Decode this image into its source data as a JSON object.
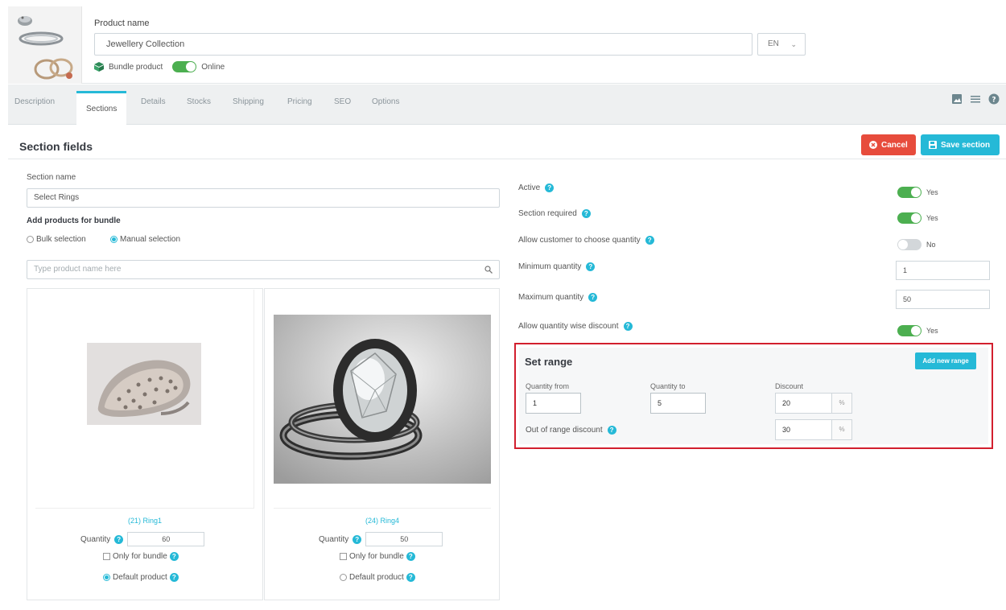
{
  "header": {
    "product_name_label": "Product name",
    "product_name_value": "Jewellery Collection",
    "language": "EN",
    "product_type": "Bundle product",
    "status_label": "Online"
  },
  "tabs": [
    "Description",
    "Sections",
    "Details",
    "Stocks",
    "Shipping",
    "Pricing",
    "SEO",
    "Options"
  ],
  "active_tab": "Sections",
  "section": {
    "title": "Section fields",
    "cancel_label": "Cancel",
    "save_label": "Save section"
  },
  "left": {
    "section_name_label": "Section name",
    "section_name_value": "Select Rings",
    "add_products_label": "Add products for bundle",
    "bulk_label": "Bulk selection",
    "manual_label": "Manual selection",
    "search_placeholder": "Type product name here"
  },
  "products": [
    {
      "link": "(21) Ring1",
      "quantity_label": "Quantity",
      "quantity": "60",
      "only_bundle": "Only for bundle",
      "default_product": "Default product",
      "default_checked": true
    },
    {
      "link": "(24) Ring4",
      "quantity_label": "Quantity",
      "quantity": "50",
      "only_bundle": "Only for bundle",
      "default_product": "Default product",
      "default_checked": false
    }
  ],
  "right": {
    "active_label": "Active",
    "active_value": "Yes",
    "required_label": "Section required",
    "required_value": "Yes",
    "choose_qty_label": "Allow customer to choose quantity",
    "choose_qty_value": "No",
    "min_qty_label": "Minimum quantity",
    "min_qty_value": "1",
    "max_qty_label": "Maximum quantity",
    "max_qty_value": "50",
    "qty_discount_label": "Allow quantity wise discount",
    "qty_discount_value": "Yes"
  },
  "range": {
    "title": "Set range",
    "add_label": "Add new range",
    "qty_from_label": "Quantity from",
    "qty_from_value": "1",
    "qty_to_label": "Quantity to",
    "qty_to_value": "5",
    "discount_label": "Discount",
    "discount_value": "20",
    "unit": "%",
    "out_of_range_label": "Out of range discount",
    "out_of_range_value": "30"
  },
  "colors": {
    "accent": "#25b9d7",
    "cancel": "#e74c3c",
    "toggle_on": "#4caf50",
    "highlight_border": "#d21f2e"
  },
  "icons": {
    "bundle": "bundle-icon",
    "help": "help-icon",
    "search": "search-icon",
    "cancel": "cancel-icon",
    "save": "save-icon"
  }
}
